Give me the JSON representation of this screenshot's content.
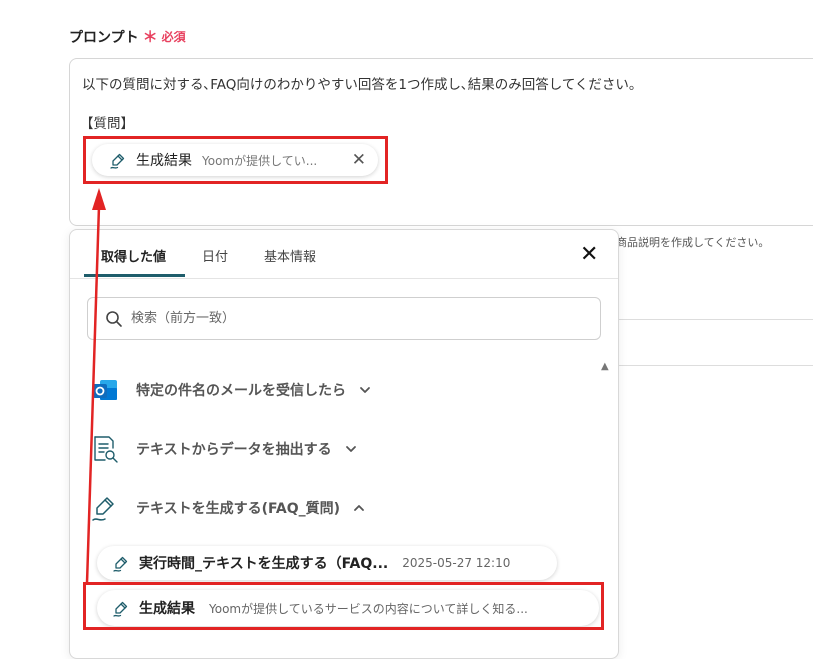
{
  "field": {
    "label": "プロンプト",
    "required_star": "＊",
    "required_text": "必須"
  },
  "prompt": {
    "line1": "以下の質問に対する､FAQ向けのわかりやすい回答を1つ作成し､結果のみ回答してください。",
    "line2": "【質問】",
    "chip": {
      "title": "生成結果",
      "subtitle": "Yoomが提供してい...",
      "close": "✕"
    }
  },
  "hint": {
    "text": "商品説明を作成してください。"
  },
  "dropdown": {
    "tabs": [
      {
        "label": "取得した値"
      },
      {
        "label": "日付"
      },
      {
        "label": "基本情報"
      }
    ],
    "close": "✕",
    "search": {
      "placeholder": "検索（前方一致）"
    },
    "groups": [
      {
        "label": "特定の件名のメールを受信したら",
        "icon": "outlook-icon",
        "expanded": false
      },
      {
        "label": "テキストからデータを抽出する",
        "icon": "document-search-icon",
        "expanded": false
      },
      {
        "label": "テキストを生成する(FAQ_質問)",
        "icon": "pen-icon",
        "expanded": true
      }
    ],
    "items": [
      {
        "title": "実行時間_テキストを生成する（FAQ...",
        "subtitle": "2025-05-27 12:10"
      },
      {
        "title": "生成結果",
        "subtitle": "Yoomが提供しているサービスの内容について詳しく知る..."
      }
    ]
  },
  "colors": {
    "required": "#e8415f",
    "highlight": "#e22424",
    "tab_active": "#1f5d6b",
    "outlook": "#0f6cbd"
  }
}
